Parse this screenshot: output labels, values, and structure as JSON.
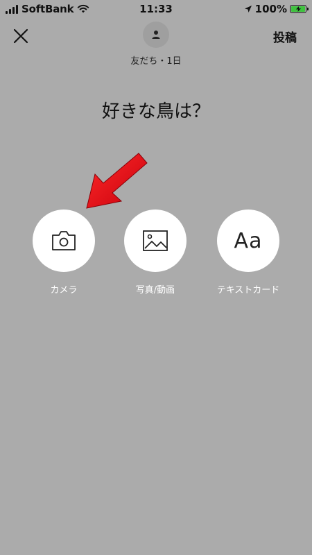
{
  "status_bar": {
    "carrier": "SoftBank",
    "time": "11:33",
    "battery": "100%"
  },
  "header": {
    "audience": "友だち・1日",
    "post_label": "投稿"
  },
  "question": "好きな鳥は？",
  "options": [
    {
      "label": "カメラ",
      "icon": "camera-icon"
    },
    {
      "label": "写真/動画",
      "icon": "image-icon"
    },
    {
      "label": "テキストカード",
      "icon": "text-card-icon",
      "glyph": "Aa"
    }
  ],
  "colors": {
    "background": "#ababab",
    "option_circle": "#ffffff",
    "arrow": "#e60012",
    "battery": "#3ec23e"
  }
}
